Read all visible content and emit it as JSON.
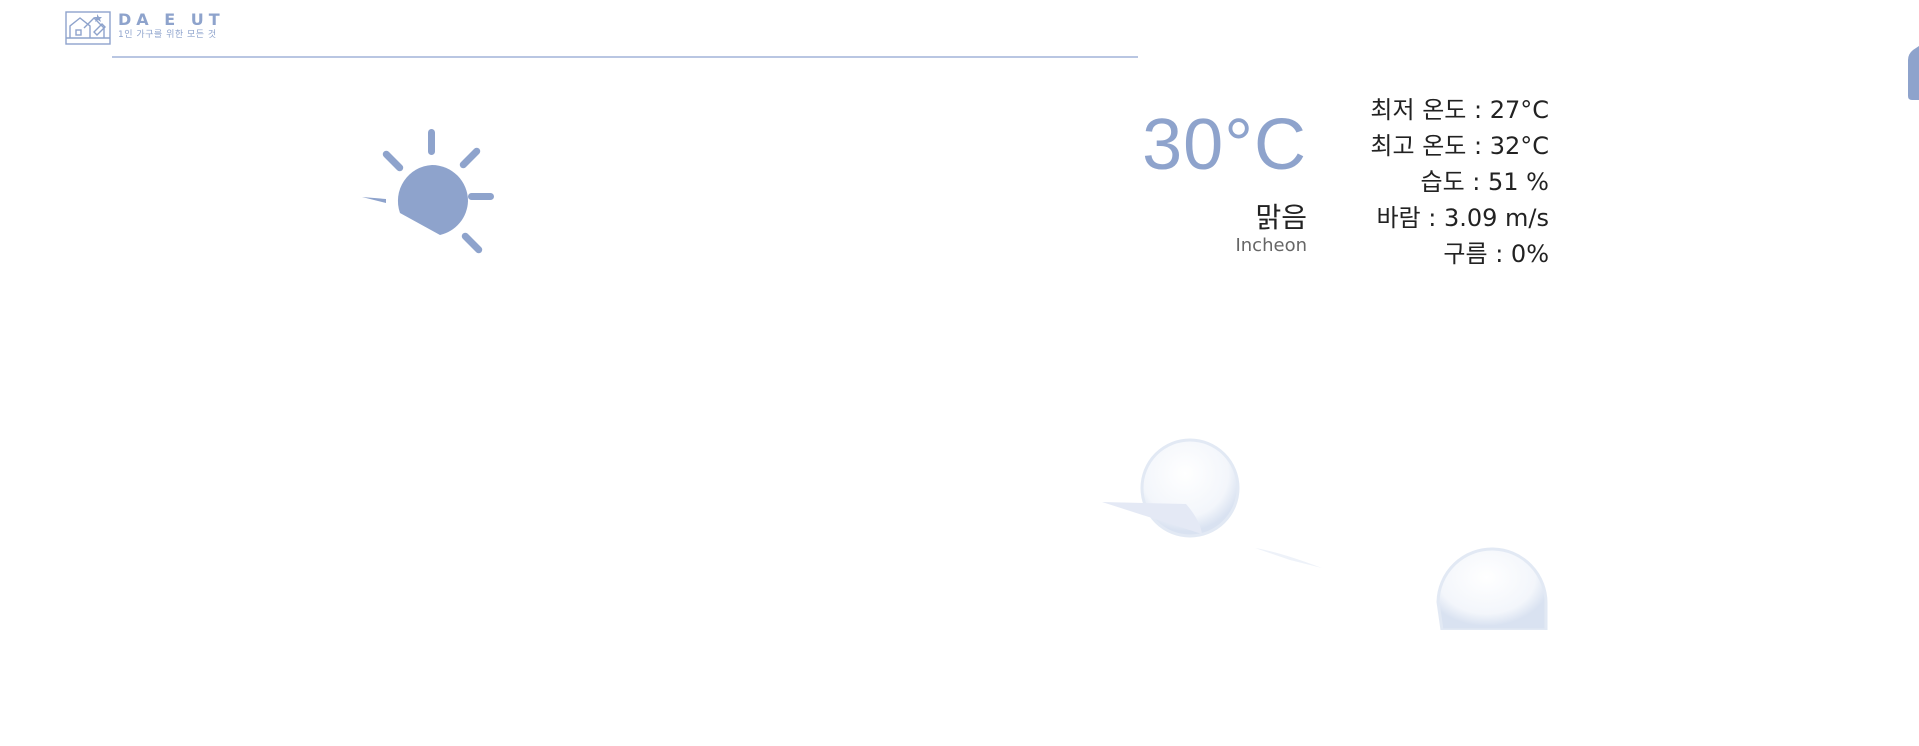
{
  "brand": {
    "name": "DA  E  UT",
    "tagline": "1인 가구를 위한 모든 것"
  },
  "weather": {
    "icon": "sun-icon",
    "temperature": "30°C",
    "condition": "맑음",
    "city": "Incheon"
  },
  "details": {
    "min_temp": "최저 온도 : 27°C",
    "max_temp": "최고 온도 : 32°C",
    "humidity": "습도 : 51 %",
    "wind": "바람 : 3.09 m/s",
    "clouds": "구름 : 0%"
  },
  "colors": {
    "accent": "#8ea3cc",
    "rule": "#b9c6e2",
    "text": "#222222",
    "muted": "#666666"
  }
}
